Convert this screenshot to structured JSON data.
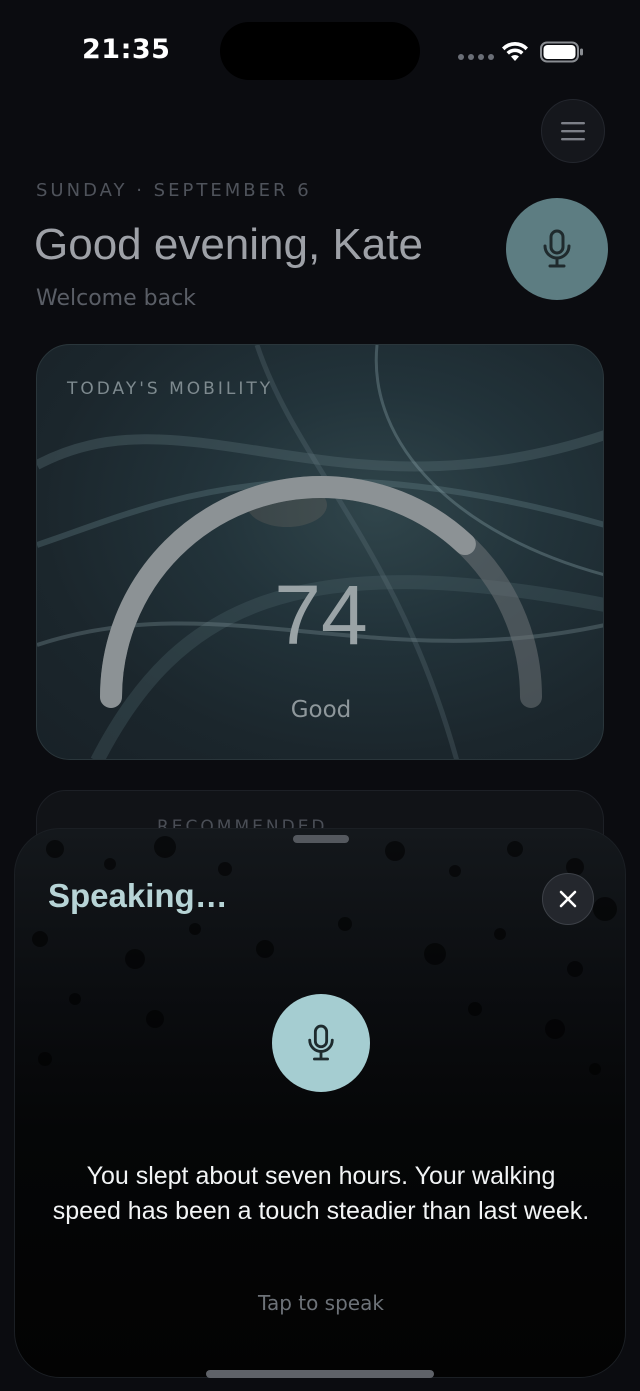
{
  "status_bar": {
    "time": "21:35"
  },
  "header": {
    "date": "SUNDAY · SEPTEMBER 6",
    "greeting": "Good evening, Kate",
    "subtitle": "Welcome back"
  },
  "mobility_card": {
    "label": "TODAY'S MOBILITY",
    "score": "74",
    "status": "Good",
    "gauge_fraction": 0.74
  },
  "recommended_card": {
    "label": "RECOMMENDED"
  },
  "voice_sheet": {
    "title": "Speaking…",
    "transcript": "You slept about seven hours. Your walking speed has been a touch steadier than last week.",
    "hint": "Tap to speak"
  },
  "icons": {
    "menu": "hamburger-icon",
    "voice": "microphone-icon",
    "close": "close-icon"
  },
  "colors": {
    "accent": "#a5cdd1",
    "speaking_text": "#b7d4d6",
    "voice_fab": "#5d7d82"
  }
}
